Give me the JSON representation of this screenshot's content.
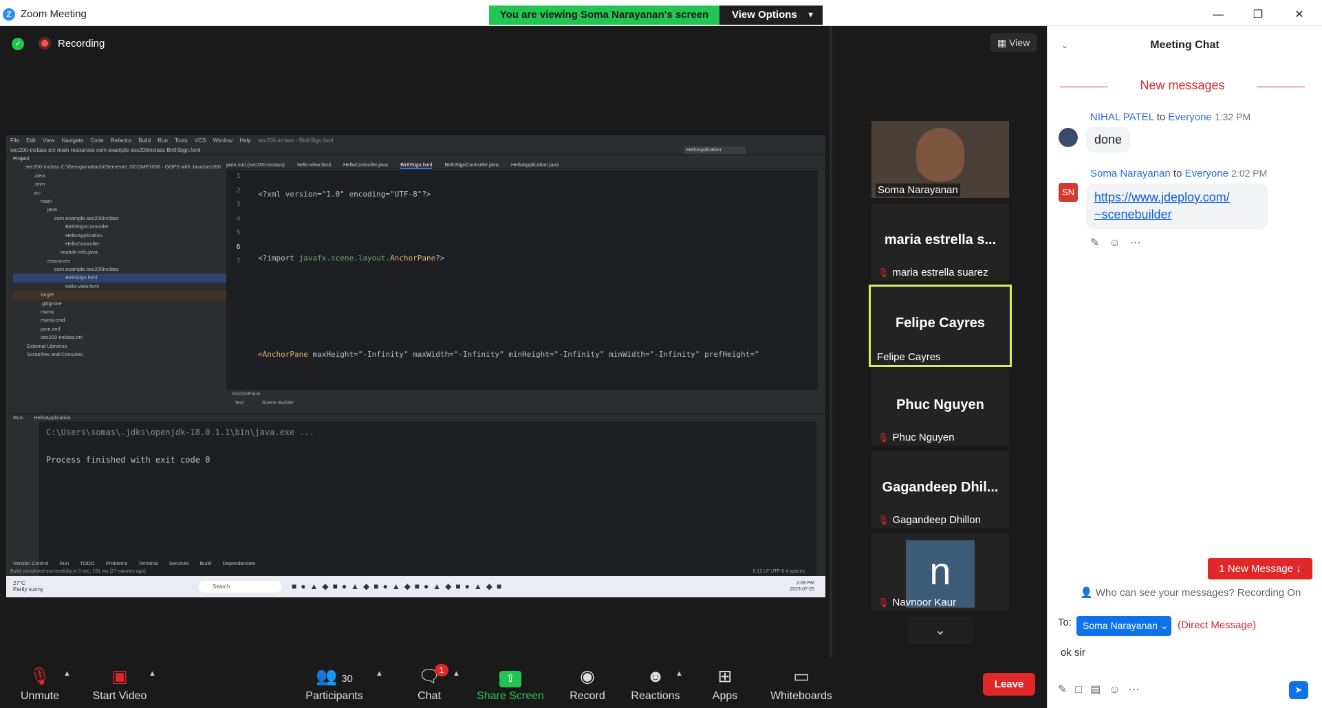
{
  "window": {
    "title": "Zoom Meeting",
    "share_banner": "You are viewing Soma Narayanan's screen",
    "view_options": "View Options"
  },
  "top": {
    "recording_label": "Recording",
    "view_label": "View"
  },
  "shared_screen": {
    "menu": [
      "File",
      "Edit",
      "View",
      "Navigate",
      "Code",
      "Refactor",
      "Build",
      "Run",
      "Tools",
      "VCS",
      "Window",
      "Help"
    ],
    "window_title": "sec200-inclass - BirthSign.fxml",
    "breadcrumb": "sec200-inclass  src  main  resources  com  example  sec200inclass  BirthSign.fxml",
    "run_config": "HelloApplication",
    "project_label": "Project",
    "tree": [
      "sec200-inclass  C:\\Georgianattachi\\Semester 2\\COMP1008 - OOPS with Java\\sec200",
      ".idea",
      ".mvn",
      "src",
      "main",
      "java",
      "com.example.sec200inclass",
      "BirthSignController",
      "HelloApplication",
      "HelloController",
      "module-info.java",
      "resources",
      "com.example.sec200inclass",
      "BirthSign.fxml",
      "hello-view.fxml",
      "target",
      ".gitignore",
      "mvnw",
      "mvnw.cmd",
      "pom.xml",
      "sec200-inclass.iml",
      "External Libraries",
      "Scratches and Consoles"
    ],
    "tabs": [
      "pom.xml (sec200-inclass)",
      "hello-view.fxml",
      "HelloController.java",
      "BirthSign.fxml",
      "BirthSignController.java",
      "HelloApplication.java"
    ],
    "gutter": [
      "1",
      "2",
      "3",
      "4",
      "5",
      "6",
      "7"
    ],
    "code": {
      "line1": "<?xml version=\"1.0\" encoding=\"UTF-8\"?>",
      "line3_prefix": "<?import ",
      "line3_pkg": "javafx.scene.layout.",
      "line3_cls": "AnchorPane",
      "line3_suffix": "?>",
      "line6_tag": "<AnchorPane",
      "line6_rest": " maxHeight=\"-Infinity\" maxWidth=\"-Infinity\" minHeight=\"-Infinity\" minWidth=\"-Infinity\" prefHeight=\""
    },
    "editor_crumb": "AnchorPane",
    "editor_tabs": [
      "Text",
      "Scene Builder"
    ],
    "run_label": "Run:",
    "run_target": "HelloApplication",
    "run_output": [
      "C:\\Users\\somas\\.jdks\\openjdk-18.0.1.1\\bin\\java.exe ...",
      "",
      "Process finished with exit code 0"
    ],
    "bottom_tabs": [
      "Version Control",
      "Run",
      "TODO",
      "Problems",
      "Terminal",
      "Services",
      "Build",
      "Dependencies"
    ],
    "status": "Build completed successfully in 3 sec, 191 ms (27 minutes ago)",
    "status_right": "6:12  LF  UTF-8  4 spaces",
    "taskbar": {
      "temp": "27°C",
      "weather": "Partly sunny",
      "search": "Search",
      "time": "2:09 PM",
      "date": "2023-07-25"
    }
  },
  "participants_tiles": [
    {
      "name": "Soma Narayanan",
      "label": ""
    },
    {
      "name": "maria estrella suarez",
      "label": "maria  estrella  s..."
    },
    {
      "name": "Felipe Cayres",
      "label": "Felipe Cayres"
    },
    {
      "name": "Phuc Nguyen",
      "label": "Phuc Nguyen"
    },
    {
      "name": "Gagandeep Dhillon",
      "label": "Gagandeep  Dhil..."
    },
    {
      "name": "Navnoor Kaur",
      "label": "n"
    }
  ],
  "chat": {
    "title": "Meeting Chat",
    "new_messages": "New messages",
    "messages": [
      {
        "sender": "NIHAL PATEL",
        "to_word": "to",
        "recipient": "Everyone",
        "time": "1:32 PM",
        "text": "done"
      },
      {
        "sender": "Soma Narayanan",
        "to_word": "to",
        "recipient": "Everyone",
        "time": "2:02 PM",
        "initials": "SN",
        "link_line1": "https://www.jdeploy.com/",
        "link_line2": "~scenebuilder"
      }
    ],
    "new_message_button": "1 New Message",
    "privacy": "Who can see your messages? Recording On",
    "to_label": "To:",
    "to_value": "Soma Narayanan",
    "direct_message": "(Direct Message)",
    "input_value": "ok sir"
  },
  "toolbar": {
    "unmute": "Unmute",
    "start_video": "Start Video",
    "participants": "Participants",
    "participants_count": "30",
    "chat": "Chat",
    "chat_badge": "1",
    "share_screen": "Share Screen",
    "record": "Record",
    "reactions": "Reactions",
    "apps": "Apps",
    "whiteboards": "Whiteboards",
    "leave": "Leave"
  },
  "colors": {
    "accent": "#0e72ed",
    "share_green": "#23c552",
    "danger": "#e02828",
    "active_speaker": "#d6f05a"
  }
}
